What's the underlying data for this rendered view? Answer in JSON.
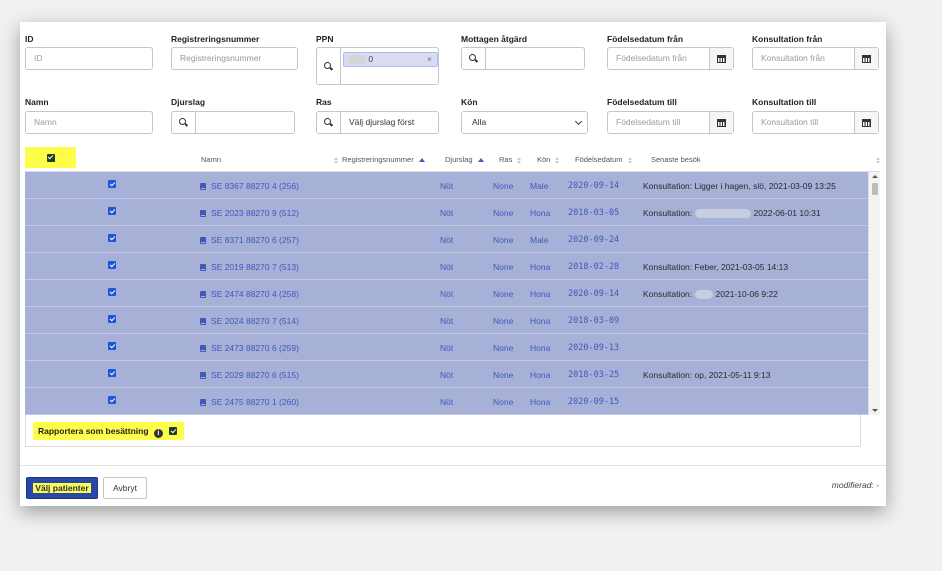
{
  "filters": {
    "id": {
      "label": "ID",
      "placeholder": "ID"
    },
    "registreringsnummer": {
      "label": "Registreringsnummer",
      "placeholder": "Registreringsnummer"
    },
    "ppn": {
      "label": "PPN",
      "tag_suffix": "0",
      "remove": "×"
    },
    "mottagen_atgard": {
      "label": "Mottagen åtgärd"
    },
    "fodelsedatum_fran": {
      "label": "Födelsedatum från",
      "placeholder": "Födelsedatum från"
    },
    "konsultation_fran": {
      "label": "Konsultation från",
      "placeholder": "Konsultation från"
    },
    "namn": {
      "label": "Namn",
      "placeholder": "Namn"
    },
    "djurslag": {
      "label": "Djurslag"
    },
    "ras": {
      "label": "Ras",
      "value": "Välj djurslag först"
    },
    "kon": {
      "label": "Kön",
      "value": "Alla"
    },
    "fodelsedatum_till": {
      "label": "Födelsedatum till",
      "placeholder": "Födelsedatum till"
    },
    "konsultation_till": {
      "label": "Konsultation till",
      "placeholder": "Konsultation till"
    }
  },
  "table": {
    "columns": {
      "namn": "Namn",
      "registreringsnummer": "Registreringsnummer",
      "djurslag": "Djurslag",
      "ras": "Ras",
      "kon": "Kön",
      "fodelsedatum": "Födelsedatum",
      "senaste_besok": "Senaste besök"
    },
    "rows": [
      {
        "namn": "SE 8367 88270 4 (256)",
        "djurslag": "Nöt",
        "ras": "None",
        "kon": "Male",
        "fodelsedatum": "2020-09-14",
        "besok_prefix": "Konsultation: ",
        "besok_text": "Ligger i hagen, slö, 2021-03-09 13:25",
        "redacted": false
      },
      {
        "namn": "SE 2023 88270 9 (512)",
        "djurslag": "Nöt",
        "ras": "None",
        "kon": "Hona",
        "fodelsedatum": "2018-03-05",
        "besok_prefix": "Konsultation: ",
        "besok_text": "2022-06-01 10:31",
        "redacted": true
      },
      {
        "namn": "SE 8371 88270 6 (257)",
        "djurslag": "Nöt",
        "ras": "None",
        "kon": "Male",
        "fodelsedatum": "2020-09-24",
        "besok_prefix": "",
        "besok_text": "",
        "redacted": false
      },
      {
        "namn": "SE 2019 88270 7 (513)",
        "djurslag": "Nöt",
        "ras": "None",
        "kon": "Hona",
        "fodelsedatum": "2018-02-28",
        "besok_prefix": "Konsultation: ",
        "besok_text": "Feber, 2021-03-05 14:13",
        "redacted": false
      },
      {
        "namn": "SE 2474 88270 4 (258)",
        "djurslag": "Nöt",
        "ras": "None",
        "kon": "Hona",
        "fodelsedatum": "2020-09-14",
        "besok_prefix": "Konsultation: ",
        "besok_text": "2021-10-06 9:22",
        "redacted": true
      },
      {
        "namn": "SE 2024 88270 7 (514)",
        "djurslag": "Nöt",
        "ras": "None",
        "kon": "Hona",
        "fodelsedatum": "2018-03-09",
        "besok_prefix": "",
        "besok_text": "",
        "redacted": false
      },
      {
        "namn": "SE 2473 88270 6 (259)",
        "djurslag": "Nöt",
        "ras": "None",
        "kon": "Hona",
        "fodelsedatum": "2020-09-13",
        "besok_prefix": "",
        "besok_text": "",
        "redacted": false
      },
      {
        "namn": "SE 2029 88270 6 (515)",
        "djurslag": "Nöt",
        "ras": "None",
        "kon": "Hona",
        "fodelsedatum": "2018-03-25",
        "besok_prefix": "Konsultation: ",
        "besok_text": "op, 2021-05-11 9:13",
        "redacted": false
      },
      {
        "namn": "SE 2475 88270 1 (260)",
        "djurslag": "Nöt",
        "ras": "None",
        "kon": "Hona",
        "fodelsedatum": "2020-09-15",
        "besok_prefix": "",
        "besok_text": "",
        "redacted": false
      }
    ]
  },
  "report_label": "Rapportera som besättning",
  "info_glyph": "i",
  "buttons": {
    "select": "Välj patienter",
    "cancel": "Avbryt"
  },
  "modified": "modifierad: -",
  "colors": {
    "highlight": "#fdfd4a",
    "selected_row": "#a7b1d8",
    "link": "#3f58b9",
    "primary": "#2847ad"
  }
}
